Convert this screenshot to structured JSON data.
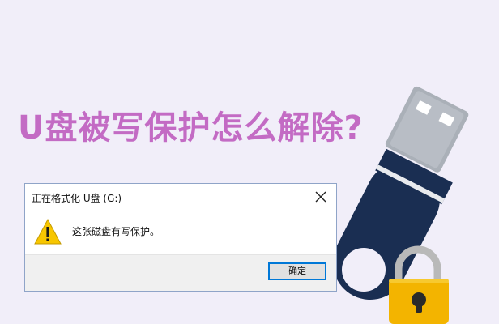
{
  "headline": "U盘被写保护怎么解除?",
  "dialog": {
    "title": "正在格式化 U盘 (G:)",
    "message": "这张磁盘有写保护。",
    "ok_label": "确定",
    "close_icon": "close-icon",
    "warning_icon": "warning-icon"
  },
  "illustration": {
    "device": "usb-drive-icon",
    "lock": "padlock-icon"
  },
  "colors": {
    "background": "#f1eef9",
    "headline": "#c36bc4",
    "usb_body": "#1a2e52",
    "connector": "#aab0b8",
    "lock_body": "#f3b400",
    "lock_shackle": "#b9b9b9",
    "warning": "#f7c600"
  }
}
